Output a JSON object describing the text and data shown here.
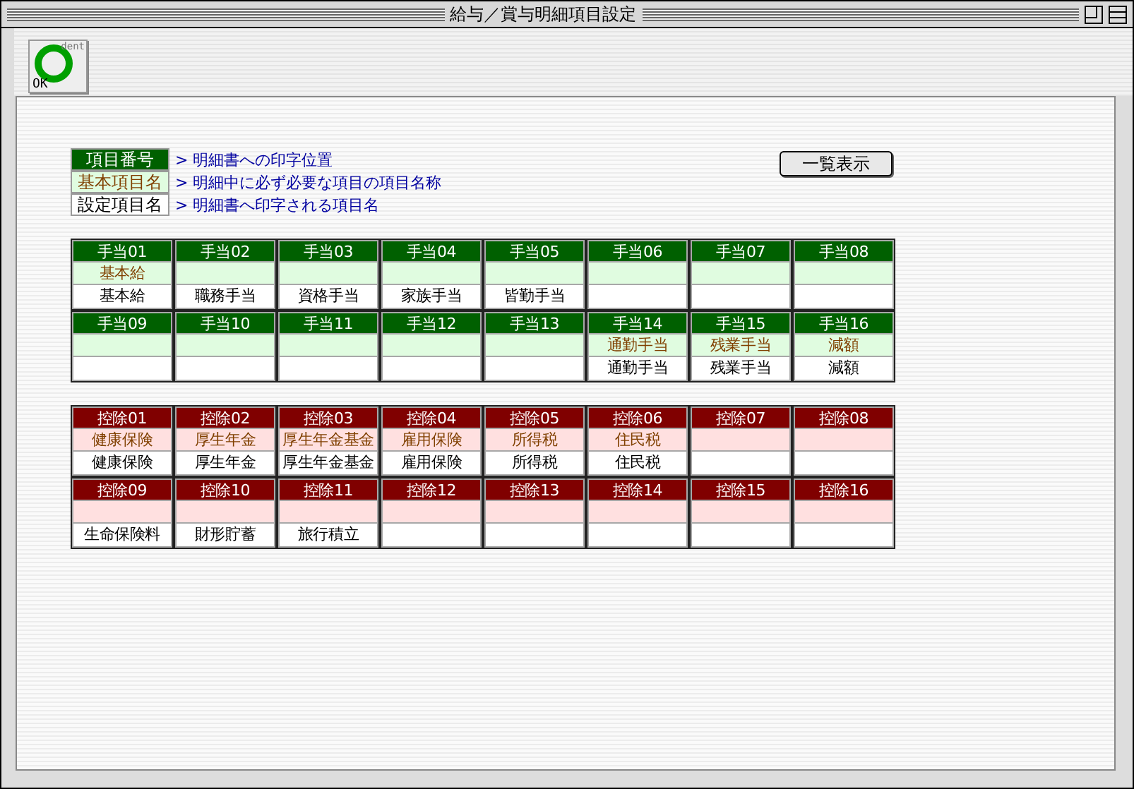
{
  "window": {
    "title": "給与／賞与明細項目設定"
  },
  "toolbar": {
    "ok_button": {
      "label": "OK",
      "corner_text": "dent"
    }
  },
  "legend": [
    {
      "kind": "number",
      "label": "項目番号",
      "description": "> 明細書への印字位置"
    },
    {
      "kind": "base",
      "label": "基本項目名",
      "description": "> 明細中に必ず必要な項目の項目名称"
    },
    {
      "kind": "name",
      "label": "設定項目名",
      "description": "> 明細書へ印字される項目名"
    }
  ],
  "list_button": {
    "label": "一覧表示"
  },
  "groups": [
    {
      "kind": "allowance",
      "cells": [
        {
          "number": "手当01",
          "base": "基本給",
          "name": "基本給"
        },
        {
          "number": "手当02",
          "name": "職務手当"
        },
        {
          "number": "手当03",
          "name": "資格手当"
        },
        {
          "number": "手当04",
          "name": "家族手当"
        },
        {
          "number": "手当05",
          "name": "皆勤手当"
        },
        {
          "number": "手当06"
        },
        {
          "number": "手当07"
        },
        {
          "number": "手当08"
        },
        {
          "number": "手当09"
        },
        {
          "number": "手当10"
        },
        {
          "number": "手当11"
        },
        {
          "number": "手当12"
        },
        {
          "number": "手当13"
        },
        {
          "number": "手当14",
          "base": "通勤手当",
          "name": "通勤手当"
        },
        {
          "number": "手当15",
          "base": "残業手当",
          "name": "残業手当"
        },
        {
          "number": "手当16",
          "base": "減額",
          "name": "減額"
        }
      ]
    },
    {
      "kind": "deduction",
      "cells": [
        {
          "number": "控除01",
          "base": "健康保険",
          "name": "健康保険"
        },
        {
          "number": "控除02",
          "base": "厚生年金",
          "name": "厚生年金"
        },
        {
          "number": "控除03",
          "base": "厚生年金基金",
          "name": "厚生年金基金"
        },
        {
          "number": "控除04",
          "base": "雇用保険",
          "name": "雇用保険"
        },
        {
          "number": "控除05",
          "base": "所得税",
          "name": "所得税"
        },
        {
          "number": "控除06",
          "base": "住民税",
          "name": "住民税"
        },
        {
          "number": "控除07"
        },
        {
          "number": "控除08"
        },
        {
          "number": "控除09",
          "name": "生命保険料"
        },
        {
          "number": "控除10",
          "name": "財形貯蓄"
        },
        {
          "number": "控除11",
          "name": "旅行積立"
        },
        {
          "number": "控除12"
        },
        {
          "number": "控除13"
        },
        {
          "number": "控除14"
        },
        {
          "number": "控除15"
        },
        {
          "number": "控除16"
        }
      ]
    }
  ]
}
